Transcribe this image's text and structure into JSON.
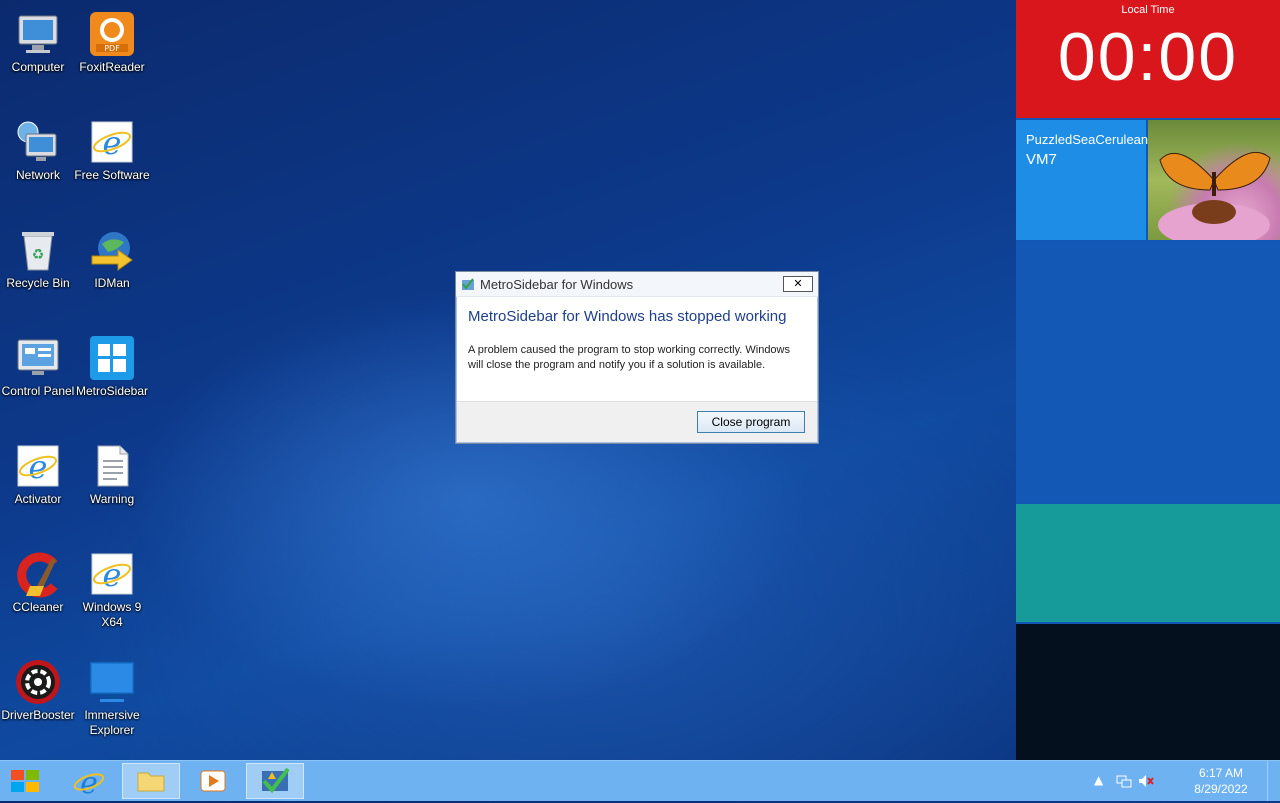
{
  "desktop_icons": [
    {
      "label": "Computer"
    },
    {
      "label": "FoxitReader"
    },
    {
      "label": "Network"
    },
    {
      "label": "Free Software"
    },
    {
      "label": "Recycle Bin"
    },
    {
      "label": "IDMan"
    },
    {
      "label": "Control Panel"
    },
    {
      "label": "MetroSidebar"
    },
    {
      "label": "Activator"
    },
    {
      "label": "Warning"
    },
    {
      "label": "CCleaner"
    },
    {
      "label": "Windows 9 X64"
    },
    {
      "label": "DriverBooster"
    },
    {
      "label": "Immersive Explorer"
    }
  ],
  "sidebar": {
    "clock_label": "Local Time",
    "clock_time": "00:00",
    "user_name": "PuzzledSeaCerulean",
    "machine_name": "VM7"
  },
  "dialog": {
    "title": "MetroSidebar for Windows",
    "heading": "MetroSidebar for Windows has stopped working",
    "message": "A problem caused the program to stop working correctly. Windows will close the program and notify you if a solution is available.",
    "close_button": "Close program",
    "close_x": "✕"
  },
  "taskbar": {
    "time": "6:17 AM",
    "date": "8/29/2022",
    "tray_arrow": "▲"
  },
  "colors": {
    "clock_tile": "#d8161c",
    "user_tile": "#1d8de6",
    "teal_tile": "#169a9a",
    "taskbar": "#6eb2f2"
  }
}
